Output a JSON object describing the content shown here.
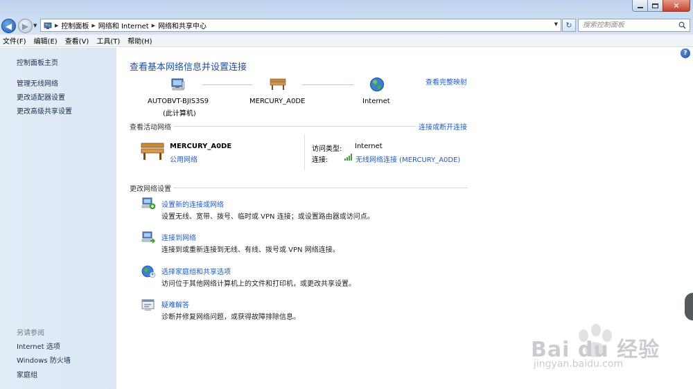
{
  "window": {
    "min_label": "minimize",
    "max_label": "maximize",
    "close_glyph": "✕"
  },
  "address": {
    "crumbs": [
      "控制面板",
      "网络和 Internet",
      "网络和共享中心"
    ]
  },
  "search": {
    "placeholder": "搜索控制面板"
  },
  "menu": [
    "文件(F)",
    "编辑(E)",
    "查看(V)",
    "工具(T)",
    "帮助(H)"
  ],
  "sidebar": {
    "home": "控制面板主页",
    "links": [
      "管理无线网络",
      "更改适配器设置",
      "更改高级共享设置"
    ],
    "see_also_heading": "另请参阅",
    "see_also": [
      "Internet 选项",
      "Windows 防火墙",
      "家庭组"
    ]
  },
  "main": {
    "title": "查看基本网络信息并设置连接",
    "full_map_link": "查看完整映射",
    "network_map": {
      "computer_name": "AUTOBVT-BJIS3S9",
      "computer_sub": "(此计算机)",
      "router_name": "MERCURY_A0DE",
      "internet_label": "Internet"
    },
    "active_heading": "查看活动网络",
    "connect_link": "连接或断开连接",
    "active_network": {
      "name": "MERCURY_A0DE",
      "type": "公用网络",
      "access_label": "访问类型:",
      "access_value": "Internet",
      "conn_label": "连接:",
      "conn_value": "无线网络连接 (MERCURY_A0DE)"
    },
    "change_heading": "更改网络设置",
    "tasks": [
      {
        "title": "设置新的连接或网络",
        "desc": "设置无线、宽带、拨号、临时或 VPN 连接；或设置路由器或访问点。"
      },
      {
        "title": "连接到网络",
        "desc": "连接到或重新连接到无线、有线、拨号或 VPN 网络连接。"
      },
      {
        "title": "选择家庭组和共享选项",
        "desc": "访问位于其他网络计算机上的文件和打印机，或更改共享设置。"
      },
      {
        "title": "疑难解答",
        "desc": "诊断并修复网络问题，或获得故障排除信息。"
      }
    ]
  },
  "watermark": {
    "text": "Bai du 经验",
    "url": "jingyan.baidu.com"
  },
  "colors": {
    "link": "#1f5bc0",
    "title": "#1e4e9b",
    "sidebar_bg": "#dbe7f5"
  }
}
